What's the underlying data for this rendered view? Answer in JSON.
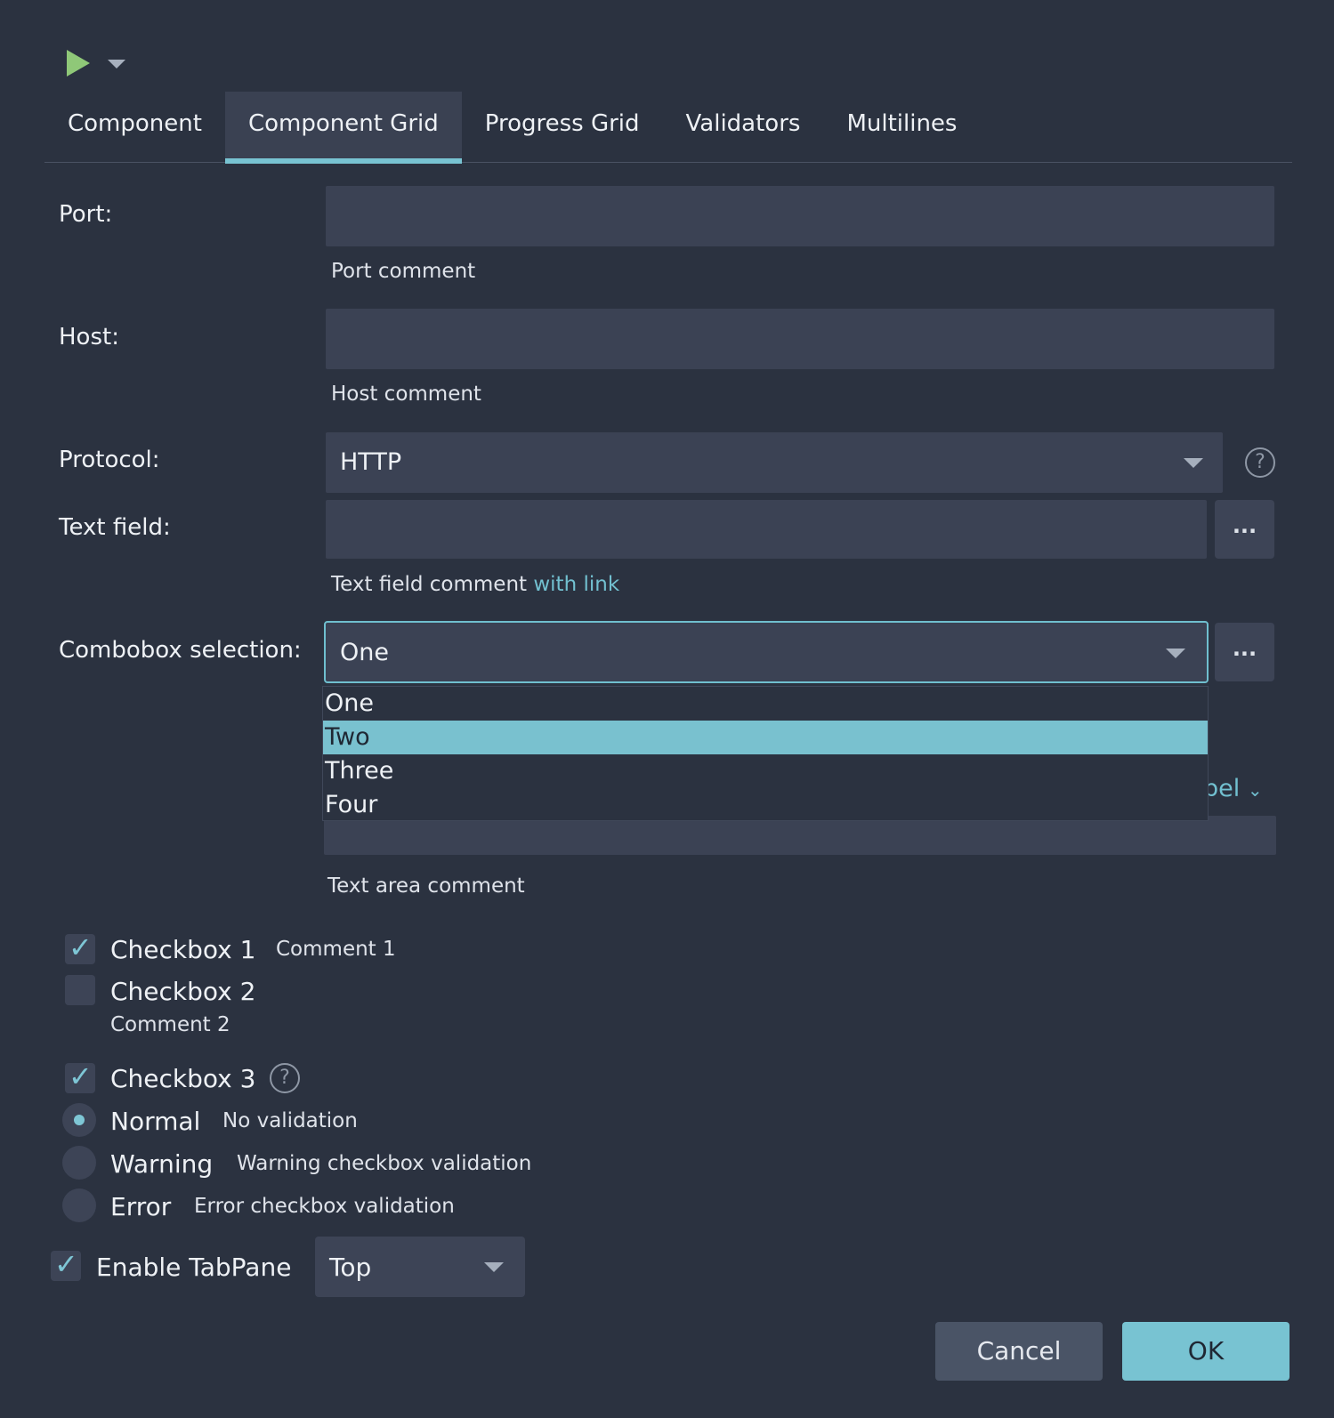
{
  "toolbar": {
    "run_icon": "play-icon",
    "caret_icon": "chevron-down-icon"
  },
  "tabs": [
    {
      "label": "Component",
      "active": false
    },
    {
      "label": "Component Grid",
      "active": true
    },
    {
      "label": "Progress Grid",
      "active": false
    },
    {
      "label": "Validators",
      "active": false
    },
    {
      "label": "Multilines",
      "active": false
    }
  ],
  "form": {
    "port_label": "Port:",
    "port_value": "",
    "port_comment": "Port comment",
    "host_label": "Host:",
    "host_value": "",
    "host_comment": "Host comment",
    "protocol_label": "Protocol:",
    "protocol_value": "HTTP",
    "text_field_label": "Text field:",
    "text_field_value": "",
    "text_field_button": "...",
    "text_field_comment": "Text field comment ",
    "text_field_comment_link": "with link",
    "combo_label": "Combobox selection:",
    "combo_value": "One",
    "combo_button": "...",
    "combo_options": [
      "One",
      "Two",
      "Three",
      "Four"
    ],
    "combo_highlighted": "Two",
    "hidden_label_fragment": "bel",
    "text_area_comment": "Text area comment"
  },
  "checkboxes": {
    "cb1_label": "Checkbox 1",
    "cb1_checked": true,
    "cb1_comment": "Comment 1",
    "cb2_label": "Checkbox 2",
    "cb2_checked": false,
    "cb2_comment": "Comment 2",
    "cb3_label": "Checkbox 3",
    "cb3_checked": true
  },
  "radios": {
    "normal_label": "Normal",
    "normal_comment": "No validation",
    "warning_label": "Warning",
    "warning_comment": "Warning checkbox validation",
    "error_label": "Error",
    "error_comment": "Error checkbox validation",
    "selected": "Normal"
  },
  "tabpane": {
    "label": "Enable TabPane",
    "checked": true,
    "position": "Top"
  },
  "buttons": {
    "cancel": "Cancel",
    "ok": "OK"
  },
  "colors": {
    "background": "#2b3240",
    "accent": "#78c3d2",
    "field": "#3b4254",
    "run": "#8fc878"
  }
}
